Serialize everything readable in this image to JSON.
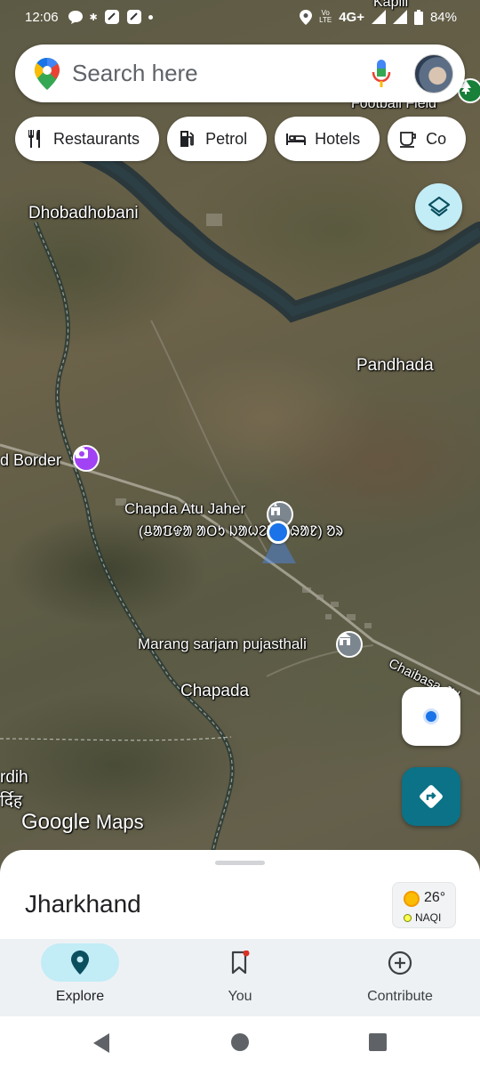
{
  "status_bar": {
    "time": "12:06",
    "network": "4G+",
    "battery": "84%"
  },
  "search": {
    "placeholder": "Search here"
  },
  "chips": [
    {
      "label": "Restaurants",
      "icon": "fork-knife-icon"
    },
    {
      "label": "Petrol",
      "icon": "fuel-pump-icon"
    },
    {
      "label": "Hotels",
      "icon": "bed-icon"
    },
    {
      "label": "Co",
      "icon": "coffee-cup-icon"
    }
  ],
  "map": {
    "places": {
      "kapili": "Kapili",
      "football_field": "Football Field",
      "dhobadhobani": "Dhobadhobani",
      "pandhada": "Pandhada",
      "border": "d Border",
      "chapda_atu_jaher_1": "Chapda Atu Jaher",
      "chapda_atu_jaher_2": "(ᱪᱟᱯᱫᱟ ᱟᱛᱩ ᱡᱟᱦᱮᱨ ᱛᱷᱟᱱ) ᱚᱨ",
      "marang": "Marang sarjam pujasthali",
      "chapada": "Chapada",
      "road": "Chaibasa-JH",
      "rdih_1": "rdih",
      "rdih_2": "र्दिह"
    },
    "watermark_google": "Google",
    "watermark_maps": "Maps"
  },
  "sheet": {
    "title": "Jharkhand",
    "temperature": "26°",
    "aqi": "NAQI"
  },
  "nav": {
    "items": [
      {
        "label": "Explore",
        "active": true
      },
      {
        "label": "You",
        "active": false
      },
      {
        "label": "Contribute",
        "active": false
      }
    ]
  },
  "colors": {
    "accent_teal": "#0b7287",
    "explore_pill": "#c2ecf6",
    "location_blue": "#1a73e8",
    "poi_purple": "#a142f4",
    "poi_gray": "#7c868e"
  }
}
